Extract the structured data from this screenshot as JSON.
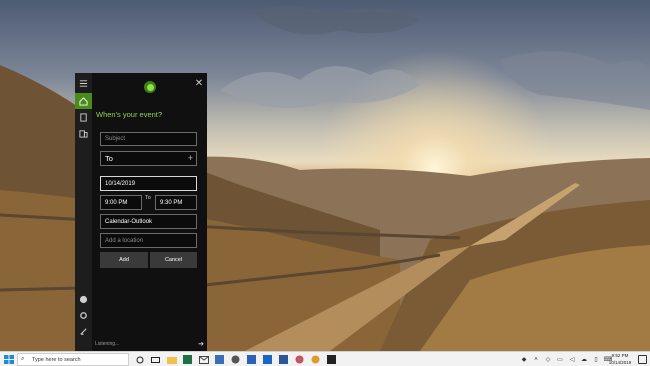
{
  "cortana": {
    "heading": "When's your event?",
    "subject_placeholder": "Subject",
    "to_label": "To",
    "date_value": "10/14/2019",
    "start_time": "9:00 PM",
    "to_separator": "To",
    "end_time": "9:30 PM",
    "calendar_value": "Calendar-Outlook",
    "location_placeholder": "Add a location",
    "add_label": "Add",
    "cancel_label": "Cancel",
    "listening_text": "Listening..."
  },
  "taskbar": {
    "search_placeholder": "Type here to search",
    "time": "9:52 PM",
    "date": "10/14/2019"
  },
  "colors": {
    "accent": "#4a8c1c",
    "heading": "#8fd14f",
    "panel_bg": "#101010"
  }
}
